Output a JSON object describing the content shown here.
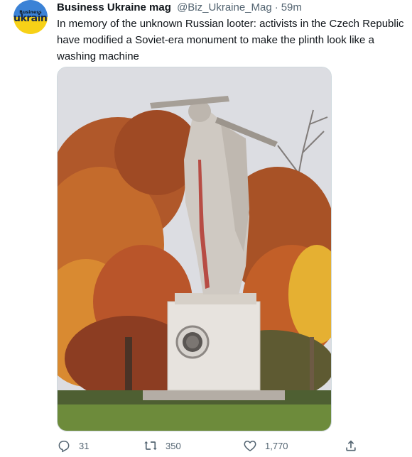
{
  "author": {
    "name": "Business Ukraine mag",
    "handle": "@Biz_Ukraine_Mag",
    "separator": "·",
    "time": "59m",
    "avatar_text_small": "Business",
    "avatar_text_big": "ukraine"
  },
  "tweet": {
    "text": "In memory of the unknown Russian looter: activists in the Czech Republic have modified a Soviet-era monument to make the plinth look like a washing machine"
  },
  "media": {
    "description_icon": "photo-of-monument"
  },
  "actions": {
    "reply_count": "31",
    "retweet_count": "350",
    "like_count": "1,770"
  },
  "colors": {
    "text_primary": "#0f1419",
    "text_secondary": "#536471",
    "border": "#cfd9de",
    "avatar_blue": "#3b82d6",
    "avatar_yellow": "#f7d117"
  }
}
